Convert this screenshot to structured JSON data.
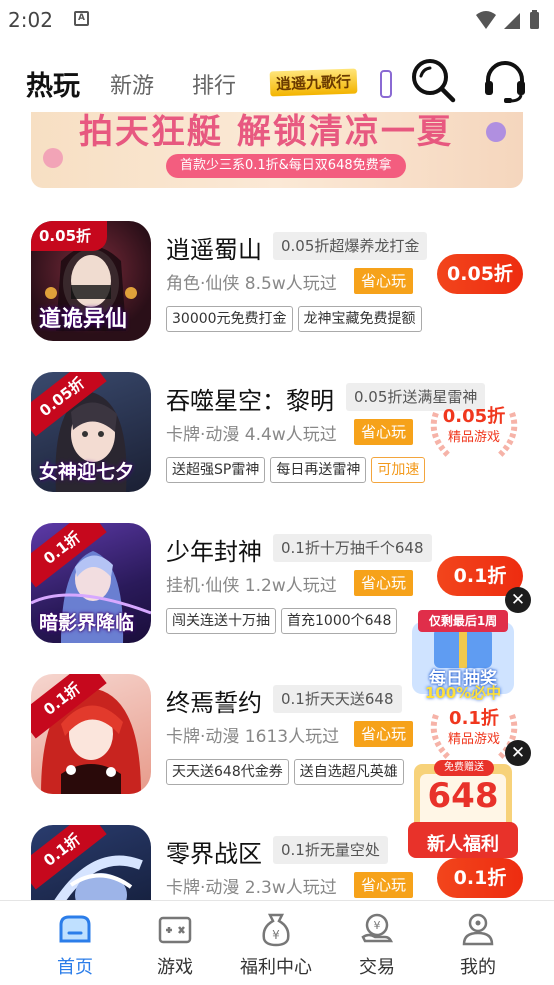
{
  "status_bar": {
    "time": "2:02",
    "notification_icon": "A"
  },
  "top_nav": {
    "tabs": [
      {
        "label": "热玩",
        "active": true
      },
      {
        "label": "新游",
        "active": false
      },
      {
        "label": "排行",
        "active": false
      }
    ],
    "logo_tab_text": "逍遥九歌行",
    "search_icon": "search-icon",
    "support_icon": "headset-icon"
  },
  "banner": {
    "title": "拍天狂艇 解锁清凉一夏",
    "subtitle": "首款少三系0.1折&每日双648免费拿"
  },
  "games": [
    {
      "name": "逍遥蜀山",
      "promo": "0.05折超爆养龙打金",
      "meta": "角色·仙侠  8.5w人玩过",
      "save_label": "省心玩",
      "tags": [
        "30000元免费打金",
        "龙神宝藏免费提额"
      ],
      "orange_tag": "",
      "price": "0.05折",
      "discount_badge": "0.05折",
      "caption": "道诡异仙"
    },
    {
      "name": "吞噬星空：黎明",
      "promo": "0.05折送满星雷神",
      "meta": "卡牌·动漫  4.4w人玩过",
      "save_label": "省心玩",
      "tags": [
        "送超强SP雷神",
        "每日再送雷神"
      ],
      "orange_tag": "可加速",
      "laurel_discount": "0.05折",
      "laurel_label": "精品游戏",
      "discount_badge": "0.05折",
      "caption": "女神迎七夕"
    },
    {
      "name": "少年封神",
      "promo": "0.1折十万抽千个648",
      "meta": "挂机·仙侠  1.2w人玩过",
      "save_label": "省心玩",
      "tags": [
        "闯关连送十万抽",
        "首充1000个648"
      ],
      "orange_tag": "",
      "price": "0.1折",
      "discount_badge": "0.1折",
      "caption": "暗影界降临"
    },
    {
      "name": "终焉誓约",
      "promo": "0.1折天天送648",
      "meta": "卡牌·动漫  1613人玩过",
      "save_label": "省心玩",
      "tags": [
        "天天送648代金券",
        "送自选超凡英雄"
      ],
      "orange_tag": "",
      "laurel_discount": "0.1折",
      "laurel_label": "精品游戏",
      "discount_badge": "0.1折",
      "caption": ""
    },
    {
      "name": "零界战区",
      "promo": "0.1折无量空处",
      "meta": "卡牌·动漫  2.3w人玩过",
      "save_label": "省心玩",
      "tags": [],
      "orange_tag": "",
      "price": "0.1折",
      "discount_badge": "0.1折",
      "caption": ""
    }
  ],
  "float_ad_lottery": {
    "ribbon": "仅剩最后1周",
    "line1": "每日抽奖",
    "line2": "100%必中"
  },
  "float_ad_gift": {
    "top": "免费赠送",
    "amount": "648",
    "label": "新人福利"
  },
  "bottom_nav": [
    {
      "label": "首页",
      "icon": "home-icon",
      "active": true
    },
    {
      "label": "游戏",
      "icon": "gamepad-icon",
      "active": false
    },
    {
      "label": "福利中心",
      "icon": "money-bag-icon",
      "active": false
    },
    {
      "label": "交易",
      "icon": "trade-icon",
      "active": false
    },
    {
      "label": "我的",
      "icon": "profile-icon",
      "active": false
    }
  ],
  "colors": {
    "accent": "#2b7de9",
    "price_red": "#ee2c10",
    "save_orange": "#f6a21a"
  }
}
